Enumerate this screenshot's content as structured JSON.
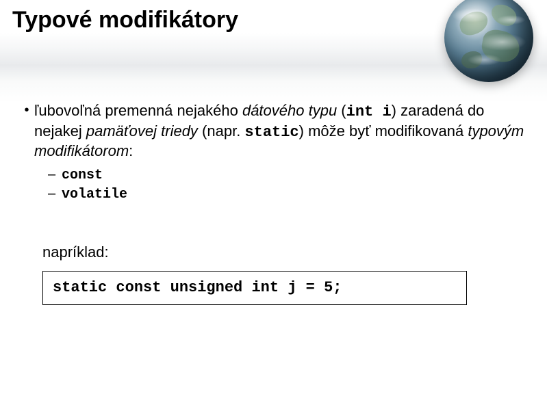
{
  "title": "Typové modifikátory",
  "bullet": {
    "part1": "ľubovoľná premenná nejakého ",
    "italic1": "dátového typu",
    "part2": " (",
    "code1": "int i",
    "part3": ") zaradená do nejakej ",
    "italic2": "pamäťovej triedy",
    "part4": " (napr. ",
    "code2": "static",
    "part5": ") môže byť modifikovaná ",
    "italic3": "typovým modifikátorom",
    "part6": ":"
  },
  "sub": {
    "item1": "const",
    "item2": "volatile"
  },
  "example_label": "napríklad:",
  "code_example": "static const unsigned int j = 5;"
}
